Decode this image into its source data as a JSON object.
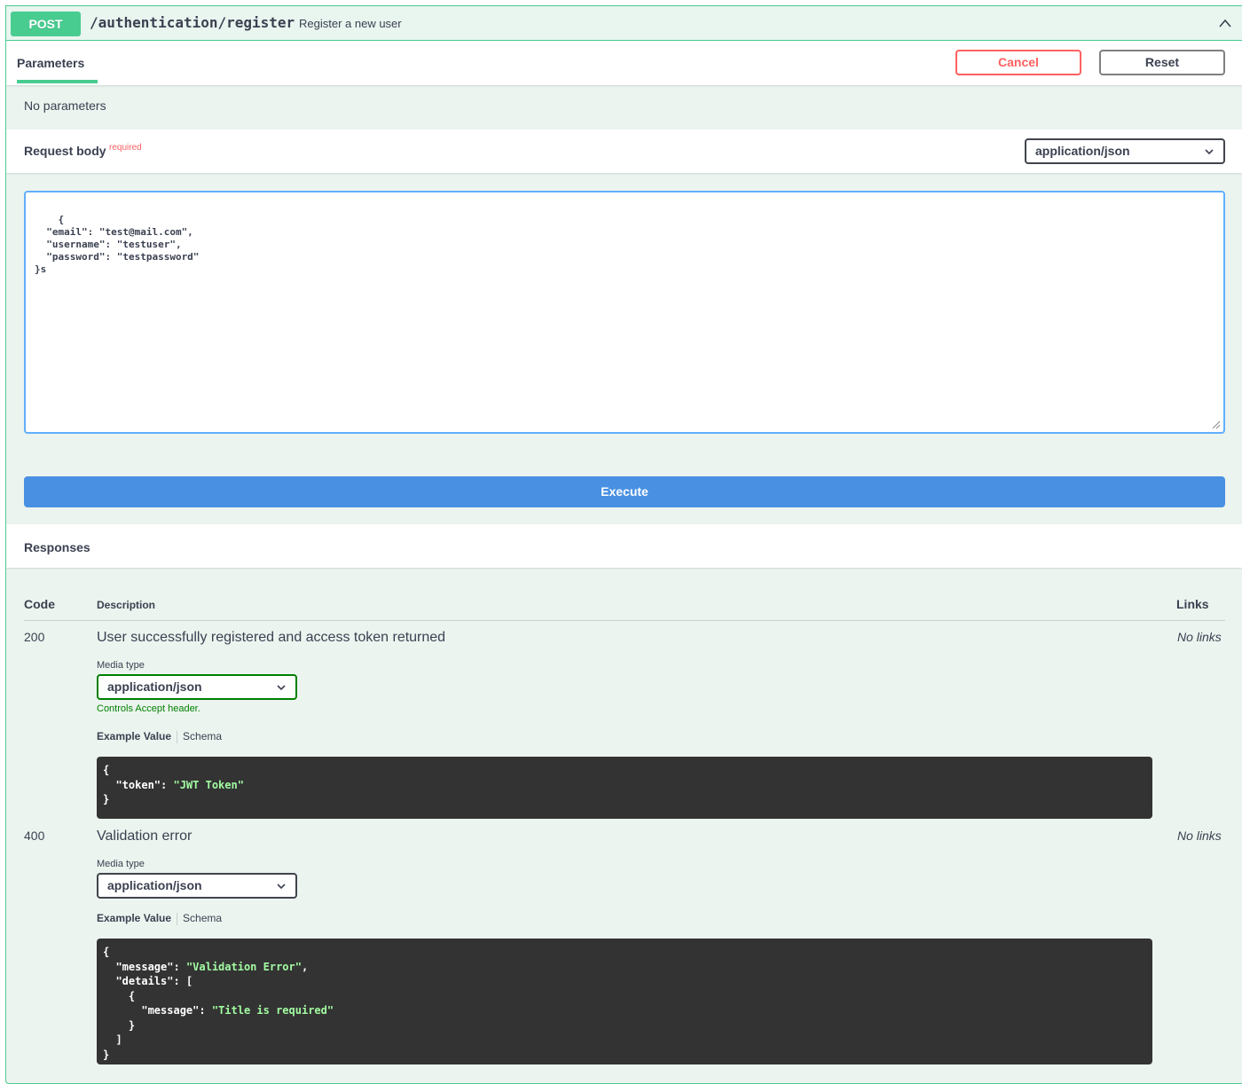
{
  "summary": {
    "method": "POST",
    "path": "/authentication/register",
    "description": "Register a new user"
  },
  "parameters": {
    "tab_label": "Parameters",
    "cancel_label": "Cancel",
    "reset_label": "Reset",
    "empty_text": "No parameters"
  },
  "request_body": {
    "title": "Request body",
    "required_label": "required",
    "content_type": "application/json",
    "body_text": "{\n  \"email\": \"test@mail.com\",\n  \"username\": \"testuser\",\n  \"password\": \"testpassword\"\n}s"
  },
  "execute_label": "Execute",
  "responses": {
    "title": "Responses",
    "headers": {
      "code": "Code",
      "description": "Description",
      "links": "Links"
    },
    "items": [
      {
        "code": "200",
        "description": "User successfully registered and access token returned",
        "links": "No links",
        "media_type_label": "Media type",
        "media_type": "application/json",
        "controls_note": "Controls Accept header.",
        "example_tab": "Example Value",
        "schema_tab": "Schema",
        "example": {
          "line1": "{",
          "key_token": "  \"token\"",
          "colon": ": ",
          "val_token": "\"JWT Token\"",
          "line3": "}"
        }
      },
      {
        "code": "400",
        "description": "Validation error",
        "links": "No links",
        "media_type_label": "Media type",
        "media_type": "application/json",
        "example_tab": "Example Value",
        "schema_tab": "Schema",
        "example": {
          "l1": "{",
          "k_message": "  \"message\"",
          "v_message": "\"Validation Error\"",
          "comma": ",",
          "k_details": "  \"details\"",
          "open_bracket": ": [",
          "l4": "    {",
          "k_inner": "      \"message\"",
          "v_inner": "\"Title is required\"",
          "l6": "    }",
          "l7": "  ]",
          "l8": "}",
          "colon": ": "
        }
      }
    ]
  }
}
